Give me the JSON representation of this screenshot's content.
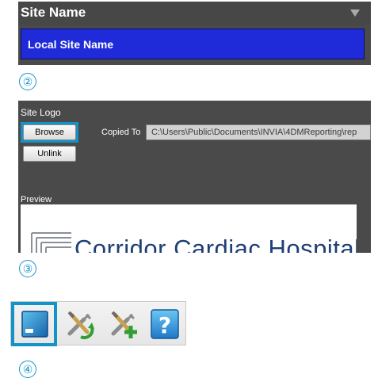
{
  "site_name": {
    "title": "Site Name",
    "value": "Local Site Name"
  },
  "steps": {
    "two": "②",
    "three": "③",
    "four": "④"
  },
  "site_logo": {
    "label": "Site Logo",
    "browse_label": "Browse",
    "unlink_label": "Unlink",
    "copied_to_label": "Copied To",
    "copied_to_value": "C:\\Users\\Public\\Documents\\INVIA\\4DMReporting\\rep",
    "preview_label": "Preview",
    "logo_text": "Corridor Cardiac Hospital"
  },
  "toolbar": {
    "buttons": [
      {
        "icon": "monitor-settings-icon"
      },
      {
        "icon": "tools-refresh-icon"
      },
      {
        "icon": "tools-add-icon"
      },
      {
        "icon": "help-icon"
      }
    ]
  },
  "colors": {
    "highlight": "#1493c8",
    "panel_bg": "#4a4a4a",
    "selected_field": "#1f2bd9",
    "logo_text": "#1f3f77"
  }
}
